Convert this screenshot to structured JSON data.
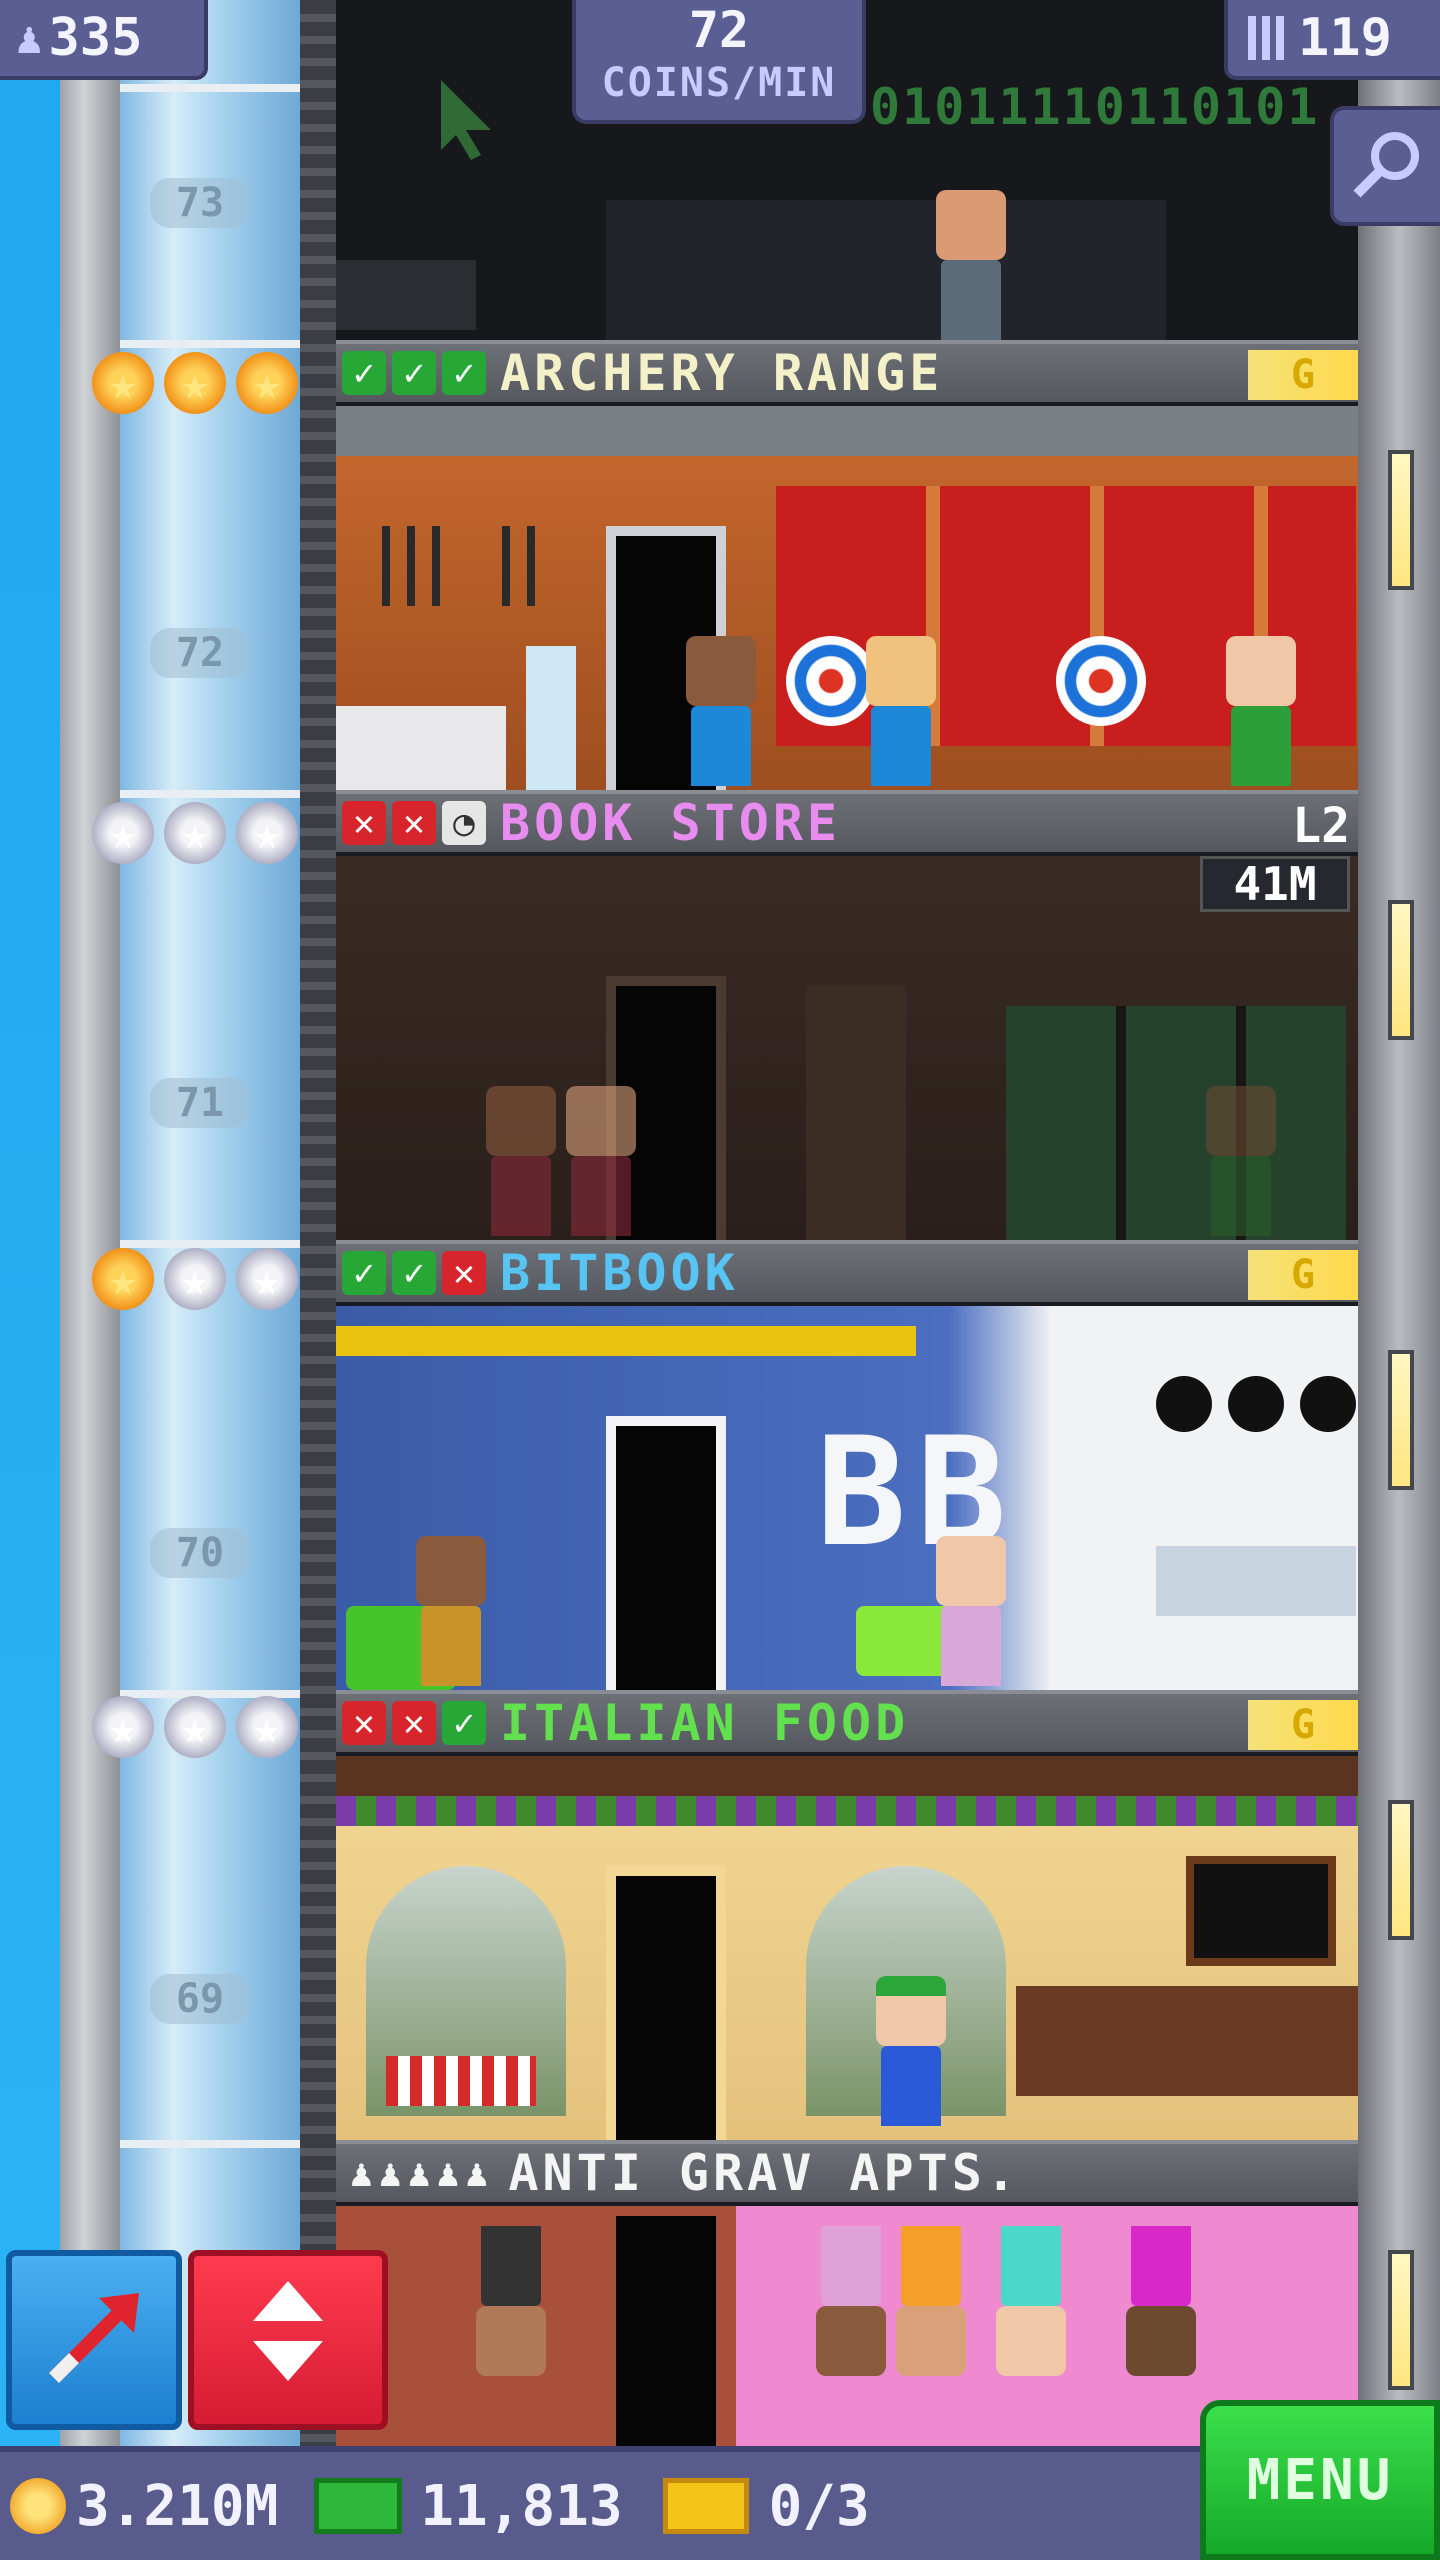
{
  "hud": {
    "population": "335",
    "coins_per_min_value": "72",
    "coins_per_min_unit": "COINS/MIN",
    "floors_count": "119",
    "binary_decor": "01011110110101"
  },
  "floors": [
    {
      "number": "73"
    },
    {
      "number": "72",
      "name": "ARCHERY RANGE",
      "name_color": "#f4f0c8",
      "status": [
        "check",
        "check",
        "check"
      ],
      "stars": [
        "on",
        "on",
        "on"
      ],
      "badge": "G"
    },
    {
      "number": "71",
      "name": "BOOK STORE",
      "name_color": "#e88cf0",
      "status": [
        "cross",
        "cross",
        "clock"
      ],
      "stars": [
        "off",
        "off",
        "off"
      ],
      "level": "L2",
      "time": "41M"
    },
    {
      "number": "70",
      "name": "BITBOOK",
      "name_color": "#58c4f4",
      "status": [
        "check",
        "check",
        "cross"
      ],
      "stars": [
        "on",
        "off",
        "off"
      ],
      "badge": "G",
      "logo": "BB"
    },
    {
      "number": "69",
      "name": "ITALIAN FOOD",
      "name_color": "#62e04e",
      "status": [
        "cross",
        "cross",
        "check"
      ],
      "stars": [
        "off",
        "off",
        "off"
      ],
      "badge": "G"
    },
    {
      "name": "ANTI GRAV APTS.",
      "name_color": "#f4f4f4",
      "residents_icons": "♟♟♟♟♟"
    }
  ],
  "bottom": {
    "coins": "3.210M",
    "bux": "11,813",
    "tickets": "0/3",
    "menu_label": "MENU"
  },
  "icons": {
    "population": "person-icon",
    "floors": "building-icon",
    "zoom": "magnifier-icon",
    "build": "arrow-icon",
    "elevator": "updown-icon"
  }
}
